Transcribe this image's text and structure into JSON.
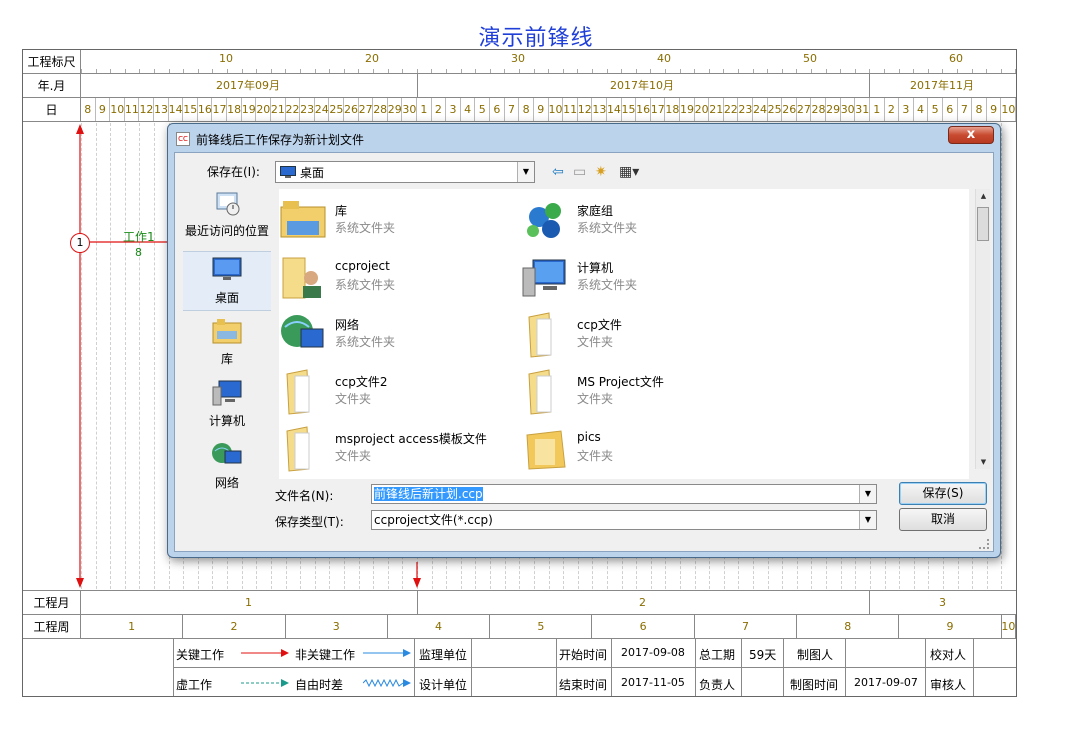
{
  "title": "演示前锋线",
  "header": {
    "row_labels": [
      "工程标尺",
      "年.月",
      "日"
    ],
    "ruler_numbers": [
      "10",
      "20",
      "30",
      "40",
      "50",
      "60"
    ],
    "months": [
      "2017年09月",
      "2017年10月",
      "2017年11月"
    ],
    "days_sep": [
      "8",
      "9",
      "10",
      "11",
      "12",
      "13",
      "14",
      "15",
      "16",
      "17",
      "18",
      "19",
      "20",
      "21",
      "22",
      "23",
      "24",
      "25",
      "26",
      "27",
      "28",
      "29",
      "30"
    ],
    "days_oct": [
      "1",
      "2",
      "3",
      "4",
      "5",
      "6",
      "7",
      "8",
      "9",
      "10",
      "11",
      "12",
      "13",
      "14",
      "15",
      "16",
      "17",
      "18",
      "19",
      "20",
      "21",
      "22",
      "23",
      "24",
      "25",
      "26",
      "27",
      "28",
      "29",
      "30",
      "31"
    ],
    "days_nov": [
      "1",
      "2",
      "3",
      "4",
      "5",
      "6",
      "7",
      "8",
      "9",
      "10"
    ]
  },
  "chart": {
    "node_label": "1",
    "task_name": "工作1",
    "task_duration": "8"
  },
  "footer": {
    "month_row_label": "工程月",
    "week_row_label": "工程周",
    "month_numbers": [
      "1",
      "2",
      "3"
    ],
    "week_numbers": [
      "1",
      "2",
      "3",
      "4",
      "5",
      "6",
      "7",
      "8",
      "9",
      "10"
    ],
    "legend": {
      "critical": "关键工作",
      "noncritical": "非关键工作",
      "virtual": "虚工作",
      "float": "自由时差"
    },
    "info": {
      "supervisor_label": "监理单位",
      "designer_label": "设计单位",
      "start_label": "开始时间",
      "start_value": "2017-09-08",
      "end_label": "结束时间",
      "end_value": "2017-11-05",
      "total_label": "总工期",
      "total_value": "59天",
      "owner_label": "负责人",
      "drawer_label": "制图人",
      "draw_time_label": "制图时间",
      "draw_time_value": "2017-09-07",
      "checker_label": "校对人",
      "reviewer_label": "审核人"
    }
  },
  "dialog": {
    "title": "前锋线后工作保存为新计划文件",
    "close_label": "x",
    "save_in_label": "保存在(I):",
    "save_in_value": "桌面",
    "places": [
      "最近访问的位置",
      "桌面",
      "库",
      "计算机",
      "网络"
    ],
    "files": [
      {
        "name": "库",
        "type": "系统文件夹"
      },
      {
        "name": "家庭组",
        "type": "系统文件夹"
      },
      {
        "name": "ccproject",
        "type": "系统文件夹"
      },
      {
        "name": "计算机",
        "type": "系统文件夹"
      },
      {
        "name": "网络",
        "type": "系统文件夹"
      },
      {
        "name": "ccp文件",
        "type": "文件夹"
      },
      {
        "name": "ccp文件2",
        "type": "文件夹"
      },
      {
        "name": "MS Project文件",
        "type": "文件夹"
      },
      {
        "name": "msproject access模板文件",
        "type": "文件夹"
      },
      {
        "name": "pics",
        "type": "文件夹"
      }
    ],
    "filename_label": "文件名(N):",
    "filename_value": "前锋线后新计划.ccp",
    "filetype_label": "保存类型(T):",
    "filetype_value": "ccproject文件(*.ccp)",
    "save_button": "保存(S)",
    "cancel_button": "取消"
  },
  "colors": {
    "title": "#1f3fd8",
    "critical": "#e01010",
    "noncritical": "#2a8ae0",
    "scale_text": "#8a6d00",
    "dialog_frame": "#bcd3ec"
  }
}
